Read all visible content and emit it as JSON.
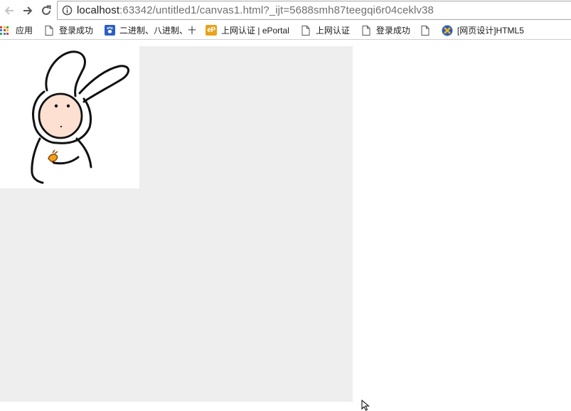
{
  "toolbar": {
    "back_icon": "arrow-left-icon",
    "forward_icon": "arrow-right-icon",
    "reload_icon": "reload-icon",
    "info_icon": "info-icon",
    "url_host": "localhost",
    "url_rest": ":63342/untitled1/canvas1.html?_ijt=5688smh87teegqi6r04ceklv38"
  },
  "bookmarks": [
    {
      "icon": "apps-grid-icon",
      "label": "应用"
    },
    {
      "icon": "page-icon",
      "label": "登录成功"
    },
    {
      "icon": "baidu-paw-icon",
      "label": "二进制、八进制、十"
    },
    {
      "icon": "eportal-icon",
      "label": "上网认证 | ePortal"
    },
    {
      "icon": "page-icon",
      "label": "上网认证"
    },
    {
      "icon": "page-icon",
      "label": "登录成功"
    },
    {
      "icon": "html5-badge-icon",
      "label": "[网页设计]HTML5"
    }
  ],
  "colors": {
    "canvas_bg": "#eeeeee",
    "image_bg": "#ffffff",
    "bunny_face": "#fde0d2",
    "bunny_carrot": "#f0a020",
    "toolbar_bg": "#ffffff"
  }
}
